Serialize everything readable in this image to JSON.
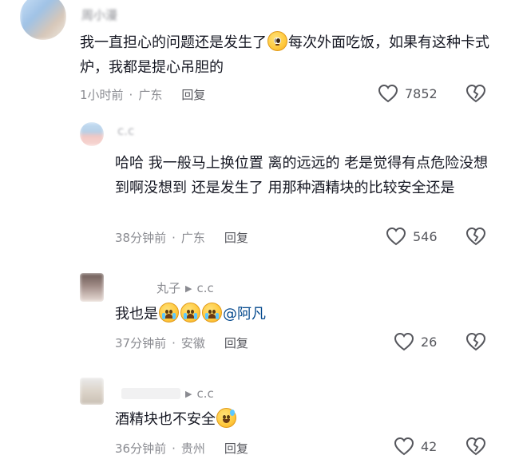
{
  "comments": [
    {
      "username": "周小漫",
      "text_before": "我一直担心的问题还是发生了",
      "text_after": "每次外面吃饭，如果有这种卡式炉，我都是提心吊胆的",
      "time": "1小时前",
      "location": "广东",
      "reply": "回复",
      "likes": "7852"
    },
    {
      "username": "c.c",
      "text": "哈哈 我一般马上换位置 离的远远的 老是觉得有点危险没想到啊没想到 还是发生了 用那种酒精块的比较安全还是",
      "time": "38分钟前",
      "location": "广东",
      "reply": "回复",
      "likes": "546"
    },
    {
      "username": "丸子",
      "reply_to": "c.c",
      "text_before": "我也是",
      "mention": "@阿凡",
      "time": "37分钟前",
      "location": "安徽",
      "reply": "回复",
      "likes": "26"
    },
    {
      "reply_to": "c.c",
      "text_before": "酒精块也不安全",
      "time": "36分钟前",
      "location": "贵州",
      "reply": "回复",
      "likes": "42"
    }
  ],
  "icons": {
    "like": "heart-outline-icon",
    "dislike": "broken-heart-icon",
    "reply_arrow": "play-triangle-icon"
  },
  "colors": {
    "text": "#161823",
    "meta": "#8a8b91",
    "mention": "#04498d"
  }
}
